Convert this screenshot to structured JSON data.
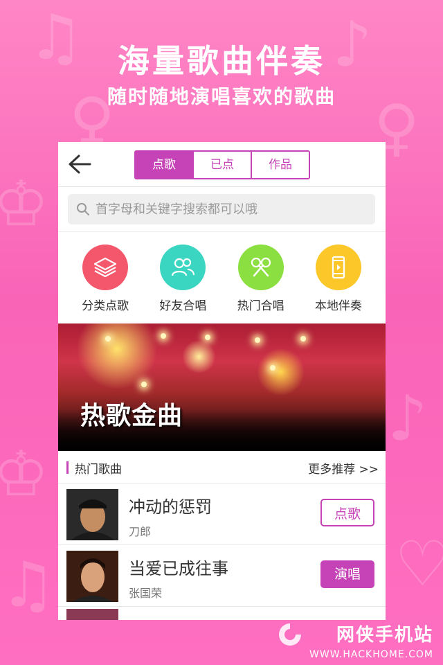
{
  "promo": {
    "headline": "海量歌曲伴奏",
    "subline": "随时随地演唱喜欢的歌曲"
  },
  "header": {
    "tabs": [
      {
        "label": "点歌",
        "active": true
      },
      {
        "label": "已点",
        "active": false
      },
      {
        "label": "作品",
        "active": false
      }
    ]
  },
  "search": {
    "placeholder": "首字母和关键字搜索都可以哦"
  },
  "categories": [
    {
      "label": "分类点歌",
      "icon": "layers-icon",
      "color": "#f4566b"
    },
    {
      "label": "好友合唱",
      "icon": "people-icon",
      "color": "#3bd6c1"
    },
    {
      "label": "热门合唱",
      "icon": "microphones-icon",
      "color": "#8bdf40"
    },
    {
      "label": "本地伴奏",
      "icon": "phone-icon",
      "color": "#fbc729"
    }
  ],
  "banner": {
    "title": "热歌金曲"
  },
  "hot_section": {
    "title": "热门歌曲",
    "more": "更多推荐 >>"
  },
  "songs": [
    {
      "title": "冲动的惩罚",
      "artist": "刀郎",
      "action": "点歌"
    },
    {
      "title": "当爱已成往事",
      "artist": "张国荣",
      "action": "演唱"
    }
  ],
  "watermark": {
    "name": "网侠手机站",
    "url": "WWW.HACKHOME.COM"
  },
  "colors": {
    "accent": "#c543b6",
    "background": "#ff7cc4"
  }
}
